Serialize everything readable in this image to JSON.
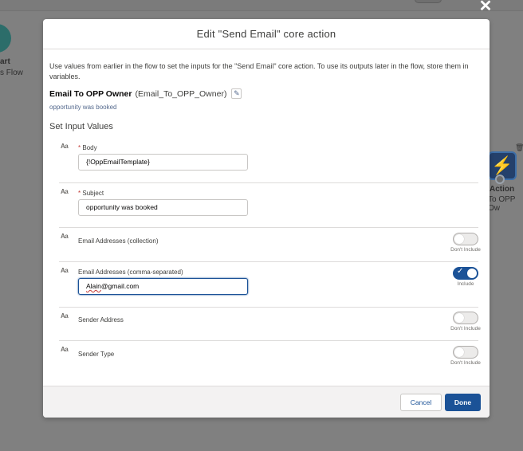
{
  "background": {
    "start_label": "art",
    "start_sublabel": "s Flow",
    "action_label": "Action",
    "action_sublabel": "To OPP Ow"
  },
  "modal": {
    "title": "Edit \"Send Email\" core action",
    "description": "Use values from earlier in the flow to set the inputs for the \"Send Email\" core action. To use its outputs later in the flow, store them in variables.",
    "action_label": "Email To OPP Owner",
    "action_api_name": "(Email_To_OPP_Owner)",
    "action_description": "opportunity was booked",
    "section_title": "Set Input Values",
    "type_icon_text": "Aa",
    "required_marker": "*",
    "params": [
      {
        "label": "Body",
        "required": true,
        "value": "{!OppEmailTemplate}"
      },
      {
        "label": "Subject",
        "required": true,
        "value": "opportunity was booked"
      },
      {
        "label": "Email Addresses (collection)",
        "toggle": "Don't Include",
        "included": false
      },
      {
        "label": "Email Addresses (comma-separated)",
        "toggle": "Include",
        "included": true,
        "value_err": "Alain",
        "value_rest": "@gmail.com"
      },
      {
        "label": "Sender Address",
        "toggle": "Don't Include",
        "included": false
      },
      {
        "label": "Sender Type",
        "toggle": "Don't Include",
        "included": false
      }
    ],
    "cancel_label": "Cancel",
    "done_label": "Done"
  },
  "colors": {
    "brand": "#1b5297",
    "required": "#c23934",
    "overlay": "#808080"
  },
  "icons": [
    "close-icon",
    "pencil-icon",
    "lightning-icon",
    "trash-icon",
    "text-type-icon",
    "check-icon"
  ]
}
